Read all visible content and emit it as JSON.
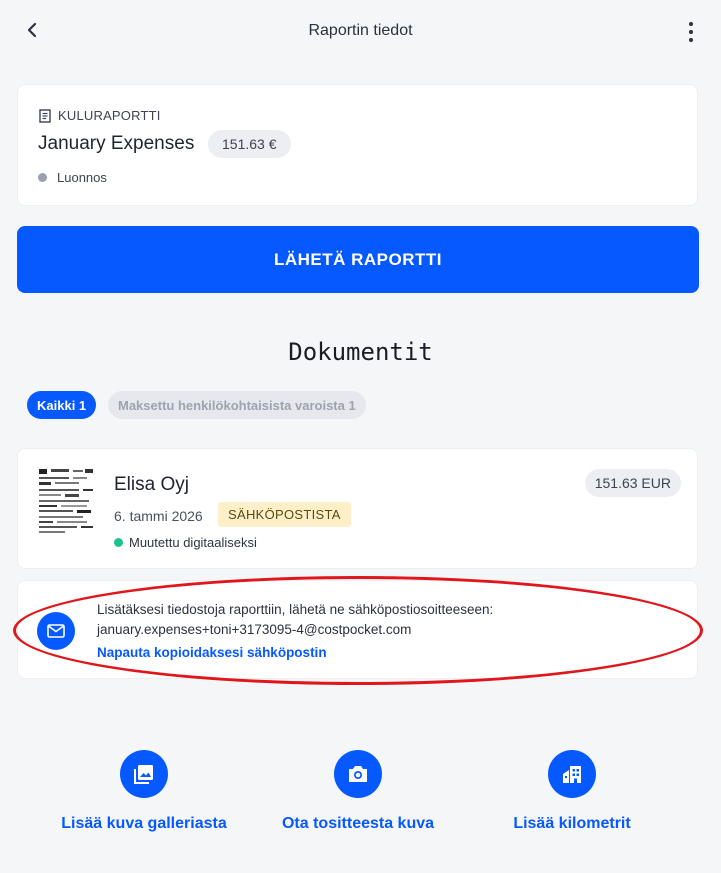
{
  "header": {
    "title": "Raportin tiedot",
    "back_icon": "chevron-left-icon",
    "menu_icon": "more-vertical-icon"
  },
  "report": {
    "type_label": "KULURAPORTTI",
    "type_icon": "receipt-icon",
    "name": "January Expenses",
    "amount": "151.63 €",
    "status": "Luonnos"
  },
  "send_button": {
    "label": "LÄHETÄ RAPORTTI"
  },
  "documents": {
    "title": "Dokumentit",
    "filters": [
      {
        "label": "Kaikki 1",
        "active": true
      },
      {
        "label": "Maksettu henkilökohtaisista varoista 1",
        "active": false
      }
    ],
    "items": [
      {
        "vendor": "Elisa Oyj",
        "amount": "151.63 EUR",
        "date": "6. tammi 2026",
        "source": "SÄHKÖPOSTISTA",
        "status": "Muutettu digitaaliseksi"
      }
    ]
  },
  "email_info": {
    "line1": "Lisätäksesi tiedostoja raporttiin, lähetä ne sähköpostiosoitteeseen:",
    "address": "january.expenses+toni+3173095-4@costpocket.com",
    "copy_link": "Napauta kopioidaksesi sähköpostin"
  },
  "actions": [
    {
      "label": "Lisää kuva galleriasta",
      "icon": "gallery-icon"
    },
    {
      "label": "Ota tositteesta kuva",
      "icon": "camera-icon"
    },
    {
      "label": "Lisää kilometrit",
      "icon": "building-icon"
    }
  ],
  "colors": {
    "accent": "#0659ff",
    "background": "#f5f6f8",
    "status_draft": "#9a9fb3",
    "status_digital": "#1fc28a",
    "source_badge_bg": "#fdf0c8",
    "highlight": "#e0161b"
  }
}
